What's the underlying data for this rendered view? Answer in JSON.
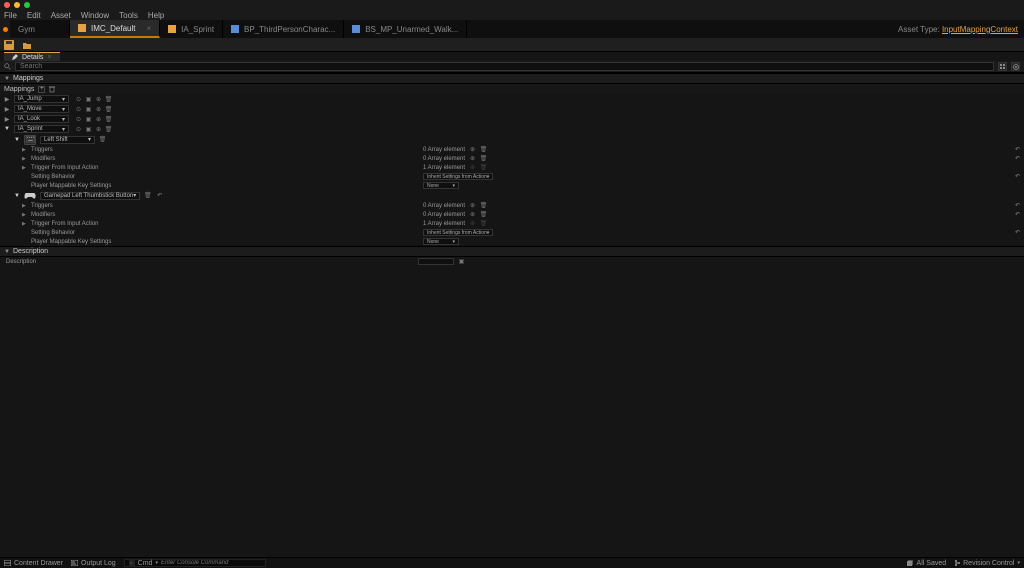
{
  "menu": {
    "file": "File",
    "edit": "Edit",
    "asset": "Asset",
    "window": "Window",
    "tools": "Tools",
    "help": "Help"
  },
  "project": "Gym",
  "tabs": [
    {
      "label": "IMC_Default",
      "color": "#e8a145",
      "active": true
    },
    {
      "label": "IA_Sprint",
      "color": "#e8a145"
    },
    {
      "label": "BP_ThirdPersonCharac...",
      "color": "#5b8dd6"
    },
    {
      "label": "BS_MP_Unarmed_Walk...",
      "color": "#5b8dd6"
    }
  ],
  "asset_type_label": "Asset Type:",
  "asset_type_value": "InputMappingContext",
  "panel": {
    "details": "Details",
    "search_placeholder": "Search"
  },
  "sections": {
    "mappings_hdr": "Mappings",
    "mappings_label": "Mappings",
    "description_hdr": "Description",
    "description_label": "Description"
  },
  "actions": [
    {
      "name": "IA_Jump"
    },
    {
      "name": "IA_Move"
    },
    {
      "name": "IA_Look"
    },
    {
      "name": "IA_Sprint"
    }
  ],
  "bindings": [
    {
      "key": "Left Shift",
      "icon": "keyboard",
      "triggers": "0 Array element",
      "modifiers": "0 Array element",
      "trigger_from": "1 Array element",
      "setting_behavior": "Inherit Settings from Action",
      "player_key": "None"
    },
    {
      "key": "Gamepad Left Thumbstick Button",
      "icon": "gamepad",
      "triggers": "0 Array element",
      "modifiers": "0 Array element",
      "trigger_from": "1 Array element",
      "setting_behavior": "Inherit Settings from Action",
      "player_key": "None"
    }
  ],
  "labels": {
    "triggers": "Triggers",
    "modifiers": "Modifiers",
    "trigger_from": "Trigger From Input Action",
    "setting_behavior": "Setting Behavior",
    "player_key": "Player Mappable Key Settings"
  },
  "status": {
    "content_drawer": "Content Drawer",
    "output_log": "Output Log",
    "cmd": "Cmd",
    "cmd_placeholder": "Enter Console Command",
    "all_saved": "All Saved",
    "revision": "Revision Control"
  }
}
